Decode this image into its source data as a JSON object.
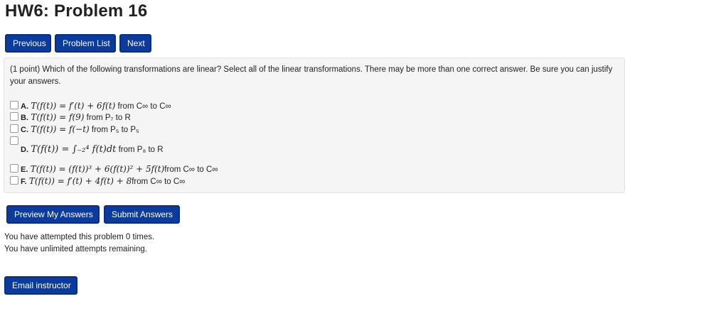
{
  "page": {
    "title": "HW6: Problem 16"
  },
  "nav": {
    "previous": "Previous",
    "problem_list": "Problem List",
    "next": "Next"
  },
  "problem": {
    "text": "(1 point) Which of the following transformations are linear? Select all of the linear transformations. There may be more than one correct answer. Be sure you can justify your answers.",
    "options": [
      {
        "label": "A.",
        "expr": "T(f(t)) = f′(t) + 6f(t)",
        "suffix": " from C∞ to C∞"
      },
      {
        "label": "B.",
        "expr": "T(f(t)) = f(9)",
        "suffix": " from P₇ to R"
      },
      {
        "label": "C.",
        "expr": "T(f(t)) = f(−t)",
        "suffix": " from P₅ to P₅"
      },
      {
        "label": "D.",
        "expr": "T(f(t)) = ∫₋₂⁴ f(t)dt",
        "suffix": " from P₈ to R"
      },
      {
        "label": "E.",
        "expr": "T(f(t)) = (f(t))³ + 6(f(t))² + 5f(t)",
        "suffix": "from C∞ to C∞"
      },
      {
        "label": "F.",
        "expr": "T(f(t)) = f′(t) + 4f(t) + 8",
        "suffix": "from C∞ to C∞"
      }
    ]
  },
  "actions": {
    "preview": "Preview My Answers",
    "submit": "Submit Answers"
  },
  "status": {
    "attempted": "You have attempted this problem 0 times.",
    "remaining": "You have unlimited attempts remaining."
  },
  "email": {
    "label": "Email instructor"
  }
}
